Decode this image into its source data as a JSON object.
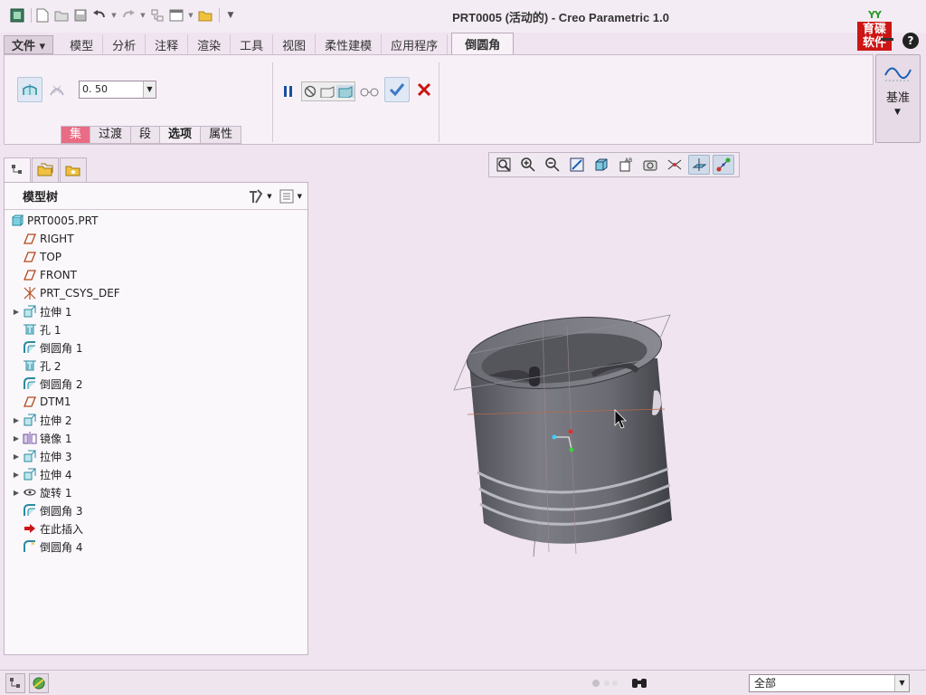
{
  "window": {
    "title": "PRT0005 (活动的) - Creo Parametric 1.0"
  },
  "logo": {
    "top_text": "YY",
    "line1": "育碟",
    "line2": "软件"
  },
  "help": {
    "label": "?"
  },
  "tabs": [
    {
      "label": "文件 ▾"
    },
    {
      "label": "模型"
    },
    {
      "label": "分析"
    },
    {
      "label": "注释"
    },
    {
      "label": "渲染"
    },
    {
      "label": "工具"
    },
    {
      "label": "视图"
    },
    {
      "label": "柔性建模"
    },
    {
      "label": "应用程序"
    },
    {
      "label": "倒圆角"
    }
  ],
  "ribbon": {
    "radius_value": "0. 50",
    "subtabs": [
      "集",
      "过渡",
      "段",
      "选项",
      "属性"
    ],
    "datum_label": "基准"
  },
  "model_tree": {
    "header": "模型树",
    "root": "PRT0005.PRT",
    "nodes": [
      {
        "label": "RIGHT",
        "icon": "datum-plane-icon",
        "expandable": false
      },
      {
        "label": "TOP",
        "icon": "datum-plane-icon",
        "expandable": false
      },
      {
        "label": "FRONT",
        "icon": "datum-plane-icon",
        "expandable": false
      },
      {
        "label": "PRT_CSYS_DEF",
        "icon": "csys-icon",
        "expandable": false
      },
      {
        "label": "拉伸 1",
        "icon": "extrude-icon",
        "expandable": true
      },
      {
        "label": "孔 1",
        "icon": "hole-icon",
        "expandable": false
      },
      {
        "label": "倒圆角 1",
        "icon": "round-icon",
        "expandable": false
      },
      {
        "label": "孔 2",
        "icon": "hole-icon",
        "expandable": false
      },
      {
        "label": "倒圆角 2",
        "icon": "round-icon",
        "expandable": false
      },
      {
        "label": "DTM1",
        "icon": "datum-plane-icon",
        "expandable": false
      },
      {
        "label": "拉伸 2",
        "icon": "extrude-icon",
        "expandable": true
      },
      {
        "label": "镜像 1",
        "icon": "mirror-icon",
        "expandable": true
      },
      {
        "label": "拉伸 3",
        "icon": "extrude-icon",
        "expandable": true
      },
      {
        "label": "拉伸 4",
        "icon": "extrude-icon",
        "expandable": true
      },
      {
        "label": "旋转 1",
        "icon": "revolve-icon",
        "expandable": true
      },
      {
        "label": "倒圆角 3",
        "icon": "round-icon",
        "expandable": false
      },
      {
        "label": "在此插入",
        "icon": "insert-here-icon",
        "expandable": false
      },
      {
        "label": "倒圆角 4",
        "icon": "round-new-icon",
        "expandable": false
      }
    ]
  },
  "statusbar": {
    "filter": "全部"
  },
  "colors": {
    "accent": "#e86c84",
    "background": "#efe4ef",
    "cancel": "#cc1111",
    "confirm": "#3a78c8"
  }
}
